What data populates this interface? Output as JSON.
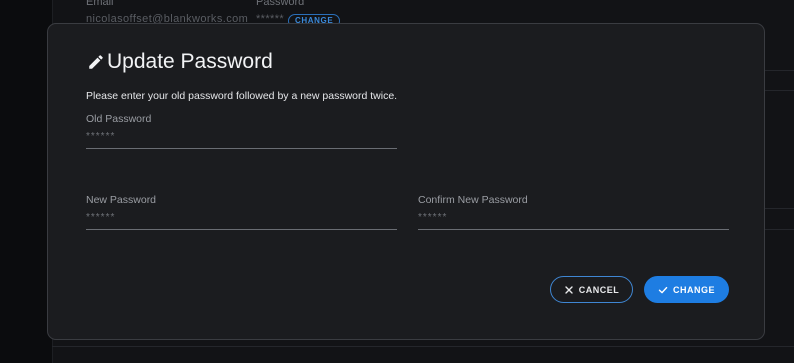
{
  "background": {
    "email_label": "Email",
    "email_value": "nicolasoffset@blankworks.com",
    "password_label": "Password",
    "password_value": "******",
    "password_badge": "CHANGE"
  },
  "modal": {
    "title": "Update Password",
    "title_icon": "pencil-icon",
    "description": "Please enter your old password followed by a new password twice.",
    "fields": {
      "old_password": {
        "label": "Old Password",
        "placeholder": "******",
        "value": ""
      },
      "new_password": {
        "label": "New Password",
        "placeholder": "******",
        "value": ""
      },
      "confirm_password": {
        "label": "Confirm New Password",
        "placeholder": "******",
        "value": ""
      }
    },
    "buttons": {
      "cancel": {
        "label": "CANCEL",
        "icon": "close-icon"
      },
      "change": {
        "label": "CHANGE",
        "icon": "check-icon"
      }
    }
  },
  "colors": {
    "accent": "#1e7de2",
    "modal_bg": "#1b1c1f",
    "page_bg": "#0b0c0e"
  }
}
